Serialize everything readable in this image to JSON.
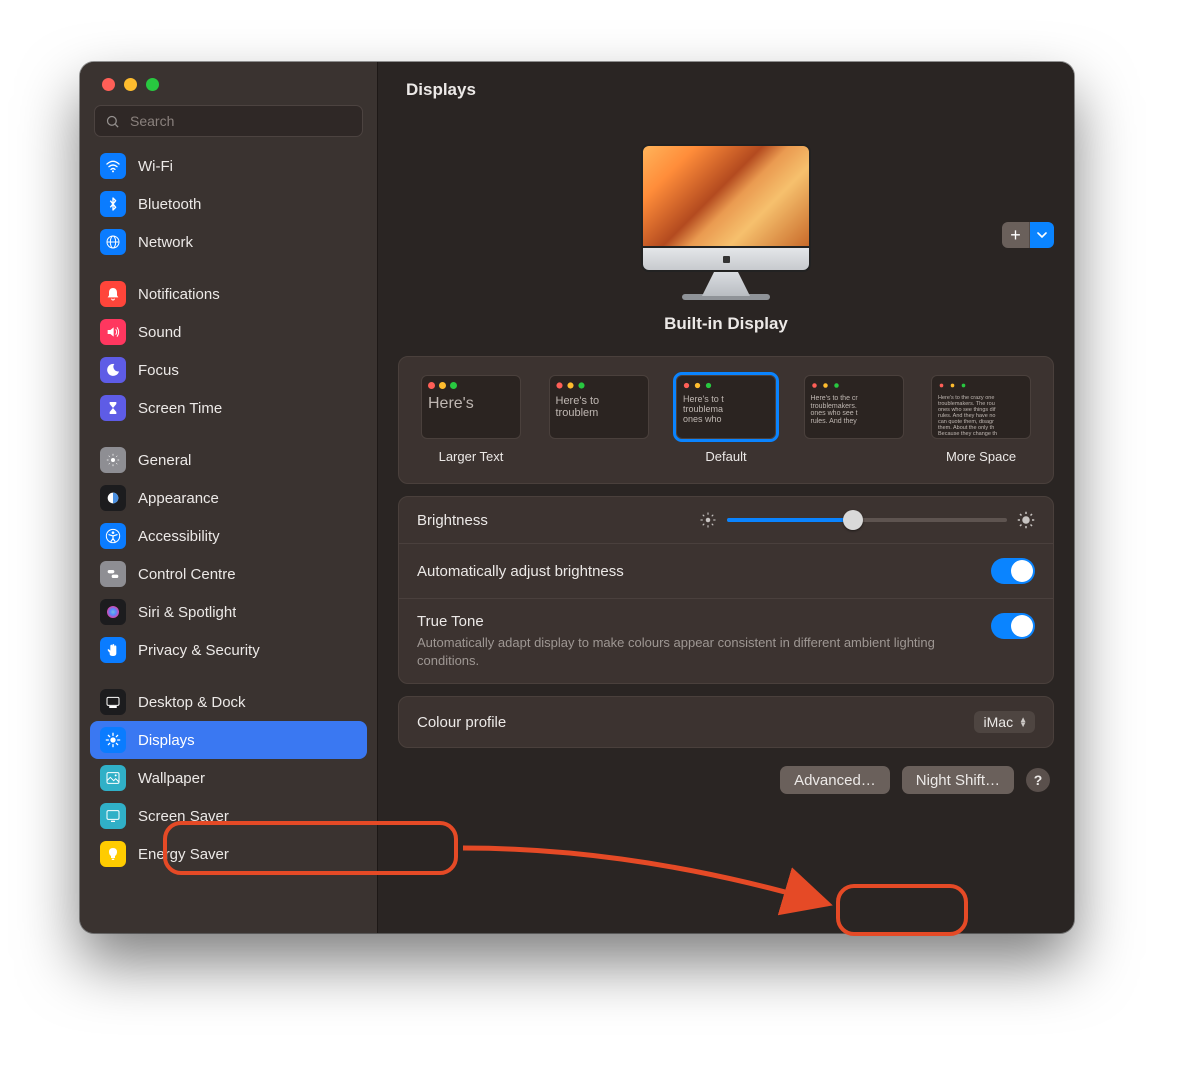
{
  "window": {
    "title": "Displays",
    "search_placeholder": "Search"
  },
  "sidebar": {
    "items": [
      {
        "id": "wifi",
        "label": "Wi-Fi",
        "color": "#0a7cff",
        "icon": "wifi"
      },
      {
        "id": "bluetooth",
        "label": "Bluetooth",
        "color": "#0a7cff",
        "icon": "bluetooth"
      },
      {
        "id": "network",
        "label": "Network",
        "color": "#0a7cff",
        "icon": "globe"
      },
      {
        "id": "notifications",
        "label": "Notifications",
        "color": "#ff453a",
        "icon": "bell"
      },
      {
        "id": "sound",
        "label": "Sound",
        "color": "#ff375f",
        "icon": "speaker"
      },
      {
        "id": "focus",
        "label": "Focus",
        "color": "#5e5ce6",
        "icon": "moon"
      },
      {
        "id": "screentime",
        "label": "Screen Time",
        "color": "#5e5ce6",
        "icon": "hourglass"
      },
      {
        "id": "general",
        "label": "General",
        "color": "#8e8e93",
        "icon": "gear"
      },
      {
        "id": "appearance",
        "label": "Appearance",
        "color": "#1c1c1e",
        "icon": "appearance"
      },
      {
        "id": "accessibility",
        "label": "Accessibility",
        "color": "#0a7cff",
        "icon": "accessibility"
      },
      {
        "id": "controlcentre",
        "label": "Control Centre",
        "color": "#8e8e93",
        "icon": "switches"
      },
      {
        "id": "siri",
        "label": "Siri & Spotlight",
        "color": "#1c1c1e",
        "icon": "siri"
      },
      {
        "id": "privacy",
        "label": "Privacy & Security",
        "color": "#0a7cff",
        "icon": "hand"
      },
      {
        "id": "desktopdock",
        "label": "Desktop & Dock",
        "color": "#1c1c1e",
        "icon": "dock"
      },
      {
        "id": "displays",
        "label": "Displays",
        "color": "#0a7cff",
        "icon": "sun",
        "selected": true
      },
      {
        "id": "wallpaper",
        "label": "Wallpaper",
        "color": "#30b0c7",
        "icon": "wallpaper"
      },
      {
        "id": "screensaver",
        "label": "Screen Saver",
        "color": "#30b0c7",
        "icon": "screensaver"
      },
      {
        "id": "energysaver",
        "label": "Energy Saver",
        "color": "#ffcc00",
        "icon": "bulb"
      }
    ],
    "groups": [
      [
        0,
        1,
        2
      ],
      [
        3,
        4,
        5,
        6
      ],
      [
        7,
        8,
        9,
        10,
        11,
        12
      ],
      [
        13,
        14,
        15,
        16,
        17
      ]
    ]
  },
  "main": {
    "display_name": "Built-in Display",
    "add_button": "+",
    "resolutions": [
      {
        "sample": "Here's",
        "caption": "Larger Text"
      },
      {
        "sample": "Here's to\\ntroublem",
        "caption": ""
      },
      {
        "sample": "Here's to t\\ntroublema\\nones who",
        "caption": "Default",
        "selected": true
      },
      {
        "sample": "Here's to the cr\\ntroublemakers.\\nones who see t\\nrules. And they",
        "caption": ""
      },
      {
        "sample": "Here's to the crazy one\\ntroublemakers. The rou\\nones who see things dif\\nrules. And they have no\\ncan quote them, disagr\\nthem. About the only th\\nBecause they change th",
        "caption": "More Space"
      }
    ],
    "brightness": {
      "label": "Brightness",
      "value": 0.45
    },
    "auto_brightness": {
      "label": "Automatically adjust brightness",
      "on": true
    },
    "true_tone": {
      "label": "True Tone",
      "on": true,
      "sub": "Automatically adapt display to make colours appear consistent in different ambient lighting conditions."
    },
    "colour_profile": {
      "label": "Colour profile",
      "value": "iMac"
    },
    "buttons": {
      "advanced": "Advanced…",
      "night_shift": "Night Shift…",
      "help": "?"
    }
  }
}
